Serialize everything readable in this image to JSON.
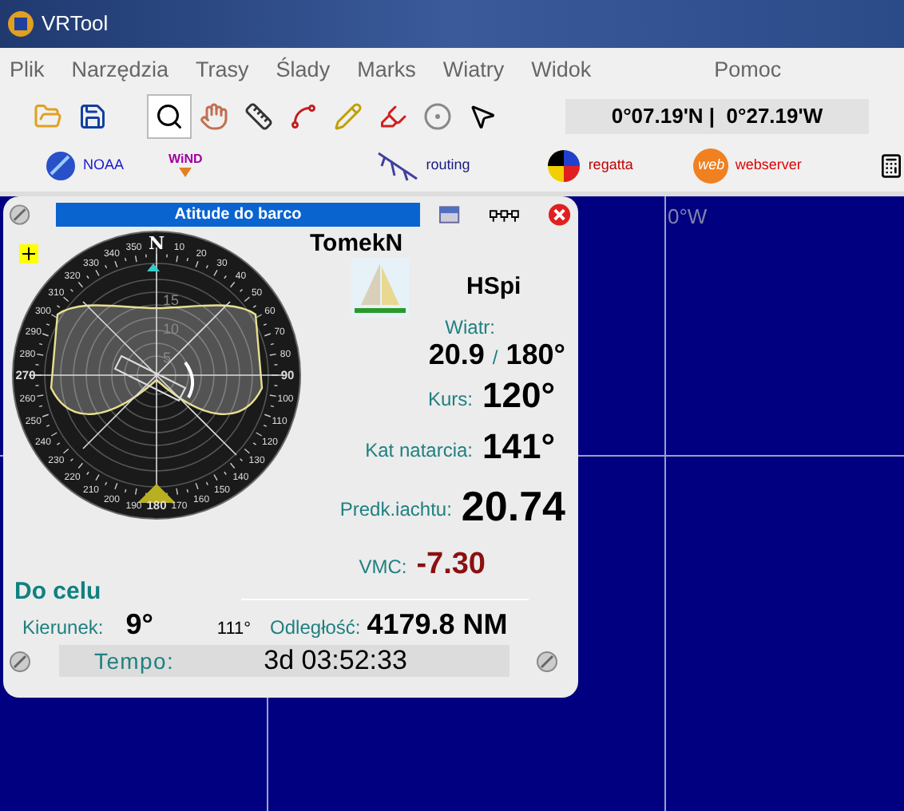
{
  "window": {
    "title": "VRTool"
  },
  "menu": [
    "Plik",
    "Narzędzia",
    "Trasy",
    "Ślady",
    "Marks",
    "Wiatry",
    "Widok",
    "Pomoc"
  ],
  "toolbar": [
    {
      "kind": "open",
      "selected": false
    },
    {
      "kind": "save",
      "selected": false
    },
    {
      "kind": "zoom",
      "selected": true
    },
    {
      "kind": "pan",
      "selected": false
    },
    {
      "kind": "ruler",
      "selected": false
    },
    {
      "kind": "route",
      "selected": false
    },
    {
      "kind": "pencil",
      "selected": false
    },
    {
      "kind": "marker",
      "selected": false
    },
    {
      "kind": "target",
      "selected": false
    },
    {
      "kind": "pointer",
      "selected": false
    }
  ],
  "coordinates": "0°07.19'N |  0°27.19'W",
  "launchers": [
    {
      "kind": "noaa",
      "label": "NOAA",
      "color": "#1a1ad0"
    },
    {
      "kind": "wind",
      "logo": "WiND"
    },
    {
      "kind": "routing",
      "label": "routing",
      "color": "#1a1a80"
    },
    {
      "kind": "regatta",
      "label": "regatta",
      "color": "#c00000"
    },
    {
      "kind": "web",
      "logo": "web",
      "label": "webserver",
      "color": "#e00000"
    }
  ],
  "map": {
    "longitude_label": "0°W"
  },
  "panel": {
    "title": "Atitude do barco",
    "compass": {
      "north": "N",
      "left_labels": [
        "350",
        "340",
        "330",
        "320",
        "310",
        "300",
        "290",
        "280",
        "270",
        "260",
        "250",
        "240",
        "230",
        "220",
        "210",
        "200",
        "190"
      ],
      "south": "180",
      "right_labels": [
        "10",
        "20",
        "30",
        "40",
        "50",
        "60",
        "70",
        "80",
        "90",
        "100",
        "110",
        "120",
        "130",
        "140",
        "150",
        "160",
        "170"
      ],
      "ring_labels": [
        "15",
        "10",
        "5"
      ]
    },
    "boat_name": "TomekN",
    "sail": "HSpi",
    "wind": {
      "label": "Wiatr:",
      "speed": "20.9",
      "separator": "/",
      "direction": "180°"
    },
    "stats": [
      {
        "label": "Kurs:",
        "value": "120°",
        "kind": "large"
      },
      {
        "label": "Kat natarcia:",
        "value": "141°",
        "kind": "large"
      },
      {
        "label": "Predk.iachtu:",
        "value": "20.74",
        "kind": "huge"
      },
      {
        "label": "VMC:",
        "value": "-7.30",
        "kind": "alert"
      }
    ],
    "target": {
      "title": "Do celu",
      "heading_label": "Kierunek:",
      "heading": "9°",
      "bearing": "111°",
      "distance_label": "Odległość:",
      "distance": "4179.8 NM",
      "time_label": "Tempo:",
      "time": "3d 03:52:33"
    }
  }
}
